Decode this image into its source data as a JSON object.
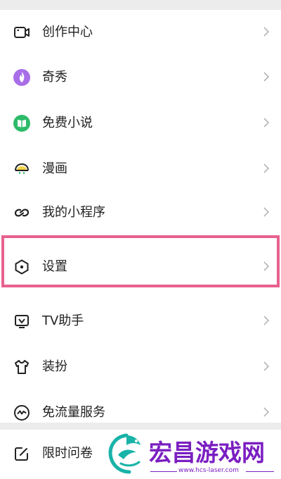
{
  "menu": {
    "items": [
      {
        "label": "创作中心",
        "icon": "video-camera-icon"
      },
      {
        "label": "奇秀",
        "icon": "flame-icon"
      },
      {
        "label": "免费小说",
        "icon": "book-icon"
      },
      {
        "label": "漫画",
        "icon": "comic-face-icon"
      },
      {
        "label": "我的小程序",
        "icon": "mini-program-icon"
      },
      {
        "label": "设置",
        "icon": "settings-hexagon-icon"
      },
      {
        "label": "TV助手",
        "icon": "tv-icon"
      },
      {
        "label": "装扮",
        "icon": "shirt-icon"
      },
      {
        "label": "免流量服务",
        "icon": "data-saver-icon"
      }
    ],
    "bottom_item": {
      "label": "限时问卷",
      "icon": "edit-square-icon"
    },
    "highlighted_item": "设置"
  },
  "watermark": {
    "text": "宏昌游戏网",
    "url": "www.hcs-laser.com"
  },
  "colors": {
    "highlight": "#e8618d",
    "qixiu_purple": "#a86ee8",
    "novel_green": "#2dbb6a",
    "watermark_purple": "#7a1fc1",
    "watermark_teal": "#19b3a8"
  }
}
